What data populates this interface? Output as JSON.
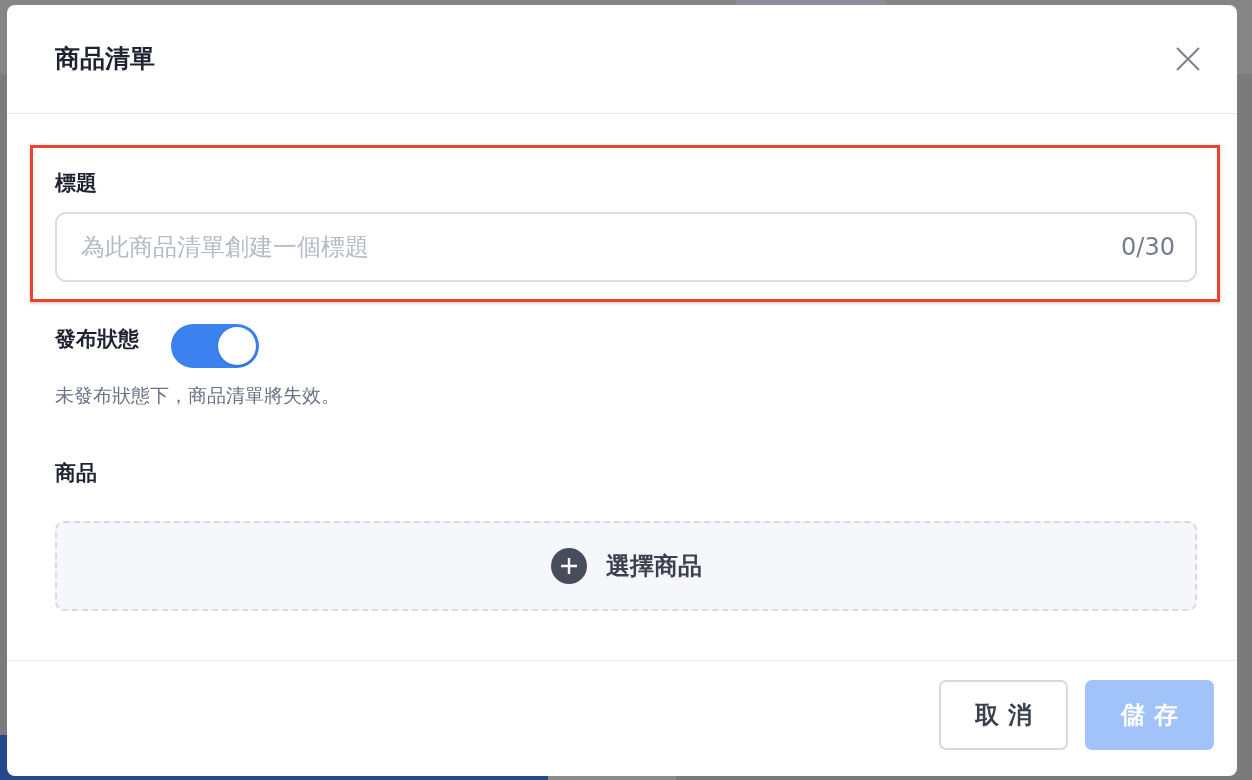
{
  "dialog": {
    "title": "商品清單"
  },
  "title_field": {
    "label": "標題",
    "placeholder": "為此商品清單創建一個標題",
    "counter": "0/30",
    "highlighted": true
  },
  "publish_status": {
    "label": "發布狀態",
    "on": true,
    "hint": "未發布狀態下，商品清單將失效。"
  },
  "products": {
    "label": "商品",
    "add_button": "選擇商品"
  },
  "footer_buttons": [
    {
      "label": "取 消",
      "kind": "secondary",
      "disabled": false
    },
    {
      "label": "儲 存",
      "kind": "primary",
      "disabled": true
    }
  ]
}
